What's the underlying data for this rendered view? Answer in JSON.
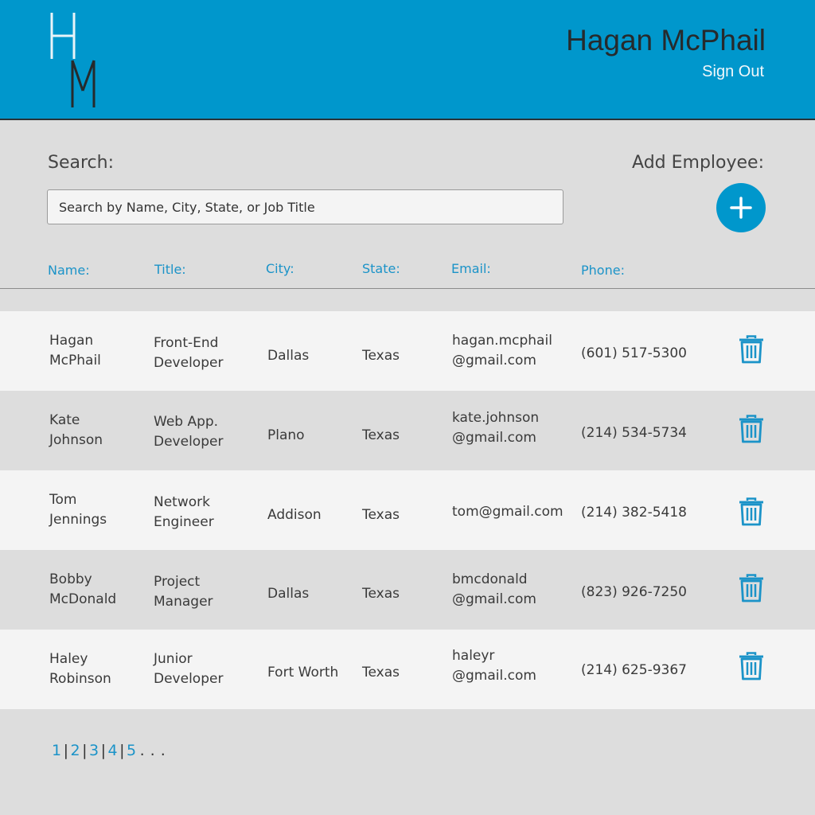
{
  "header": {
    "logo_letters": "HM",
    "user_name": "Hagan McPhail",
    "sign_out_label": "Sign Out"
  },
  "search": {
    "label": "Search:",
    "placeholder": "Search by Name, City, State, or Job Title",
    "value": ""
  },
  "add_employee": {
    "label": "Add Employee:",
    "icon": "plus-icon"
  },
  "columns": [
    "Name:",
    "Title:",
    "City:",
    "State:",
    "Email:",
    "Phone:"
  ],
  "employees": [
    {
      "name_first": "Hagan",
      "name_last": "McPhail",
      "title_1": "Front-End",
      "title_2": "Developer",
      "city": "Dallas",
      "state": "Texas",
      "email_1": "hagan.mcphail",
      "email_2": "@gmail.com",
      "phone": "(601) 517-5300"
    },
    {
      "name_first": "Kate",
      "name_last": "Johnson",
      "title_1": "Web App.",
      "title_2": "Developer",
      "city": "Plano",
      "state": "Texas",
      "email_1": "kate.johnson",
      "email_2": "@gmail.com",
      "phone": "(214) 534-5734"
    },
    {
      "name_first": "Tom",
      "name_last": "Jennings",
      "title_1": "Network",
      "title_2": "Engineer",
      "city": "Addison",
      "state": "Texas",
      "email_1": "tom@gmail.com",
      "email_2": "",
      "phone": "(214) 382-5418"
    },
    {
      "name_first": "Bobby",
      "name_last": "McDonald",
      "title_1": "Project",
      "title_2": "Manager",
      "city": "Dallas",
      "state": "Texas",
      "email_1": "bmcdonald",
      "email_2": "@gmail.com",
      "phone": "(823) 926-7250"
    },
    {
      "name_first": "Haley",
      "name_last": "Robinson",
      "title_1": "Junior",
      "title_2": "Developer",
      "city": "Fort Worth",
      "state": "Texas",
      "email_1": "haleyr",
      "email_2": "@gmail.com",
      "phone": "(214) 625-9367"
    }
  ],
  "row_action_icon": "trash-icon",
  "pagination": {
    "pages": [
      "1",
      "2",
      "3",
      "4",
      "5"
    ],
    "separator": "|",
    "ellipsis": ". . ."
  },
  "colors": {
    "brand_blue": "#0097cc",
    "link_blue": "#1b93c8",
    "background": "#dddddd",
    "row_light": "#f4f4f4"
  }
}
